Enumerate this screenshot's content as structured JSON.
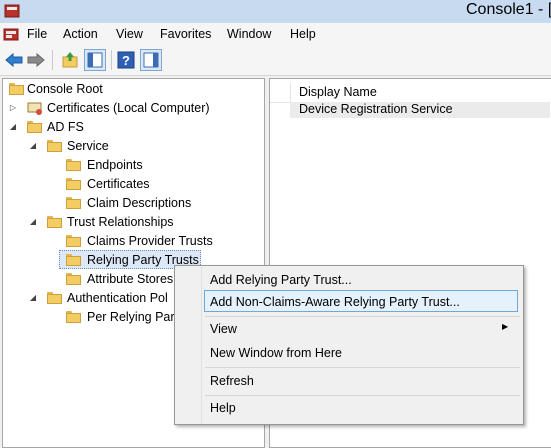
{
  "window": {
    "title": "Console1 - ["
  },
  "menu": [
    "File",
    "Action",
    "View",
    "Favorites",
    "Window",
    "Help"
  ],
  "toolbar": {
    "buttons": [
      "back-arrow-icon",
      "forward-arrow-icon",
      "up-folder-icon",
      "show-hide-tree-icon",
      "help-icon",
      "show-action-pane-icon"
    ]
  },
  "tree": {
    "items": [
      {
        "label": "Console Root"
      },
      {
        "label": "Certificates (Local Computer)"
      },
      {
        "label": "AD FS"
      },
      {
        "label": "Service"
      },
      {
        "label": "Endpoints"
      },
      {
        "label": "Certificates"
      },
      {
        "label": "Claim Descriptions"
      },
      {
        "label": "Trust Relationships"
      },
      {
        "label": "Claims Provider Trusts"
      },
      {
        "label": "Relying Party Trusts"
      },
      {
        "label": "Attribute Stores"
      },
      {
        "label": "Authentication Pol"
      },
      {
        "label": "Per Relying Part"
      }
    ]
  },
  "list": {
    "column": "Display Name",
    "rows": [
      "Device Registration Service"
    ]
  },
  "context_menu": {
    "items": [
      "Add Relying Party Trust...",
      "Add Non-Claims-Aware Relying Party Trust...",
      "View",
      "New Window from Here",
      "Refresh",
      "Help"
    ]
  },
  "colors": {
    "titlebar": "#c8daf0",
    "highlight": "#e5f1fb",
    "folder": "#f3cd62"
  }
}
